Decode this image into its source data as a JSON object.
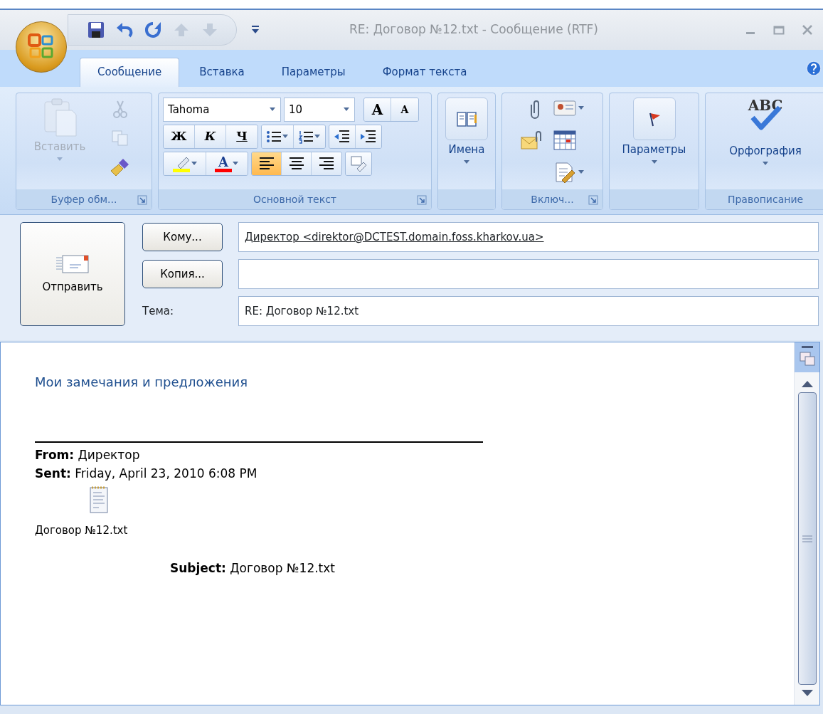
{
  "window": {
    "title": "RE: Договор №12.txt - Сообщение (RTF)"
  },
  "quick_access": [
    {
      "kind": "save",
      "disabled": false
    },
    {
      "kind": "undo",
      "disabled": false
    },
    {
      "kind": "redo",
      "disabled": false
    },
    {
      "kind": "up",
      "disabled": true
    },
    {
      "kind": "down",
      "disabled": true
    }
  ],
  "tabs": [
    {
      "label": "Сообщение",
      "selected": true
    },
    {
      "label": "Вставка",
      "selected": false
    },
    {
      "label": "Параметры",
      "selected": false
    },
    {
      "label": "Формат текста",
      "selected": false
    }
  ],
  "ribbon": {
    "clipboard": {
      "label": "Буфер обм...",
      "paste": {
        "label": "Вставить",
        "disabled": true
      },
      "cut": {
        "disabled": true
      },
      "copy": {
        "disabled": true
      }
    },
    "basic_text": {
      "label": "Основной текст",
      "font": "Tahoma",
      "size": "10",
      "grow_font": "A",
      "shrink_font": "A",
      "bold": "Ж",
      "italic": "К",
      "underline": "Ч",
      "font_color": "A",
      "align": [
        {
          "selected": true
        },
        {
          "selected": false
        },
        {
          "selected": false
        }
      ]
    },
    "names": {
      "button": "Имена"
    },
    "include": {
      "label": "Включ..."
    },
    "options": {
      "button": "Параметры"
    },
    "proofing": {
      "label": "Правописание",
      "icon_text": "ABC",
      "button": "Орфография"
    }
  },
  "header": {
    "send": "Отправить",
    "to_button": "Кому...",
    "to_value": "Директор <direktor@DCTEST.domain.foss.kharkov.ua>",
    "cc_button": "Копия...",
    "subject_label": "Тема:",
    "subject_value": "RE: Договор №12.txt"
  },
  "body": {
    "greeting": "Мои замечания и предложения",
    "from": "**From:** Директор",
    "sent": "**Sent:** Friday, April 23, 2010 6:08 PM",
    "attachment": "Договор №12.txt",
    "subject": "**Subject:** Договор №12.txt"
  }
}
